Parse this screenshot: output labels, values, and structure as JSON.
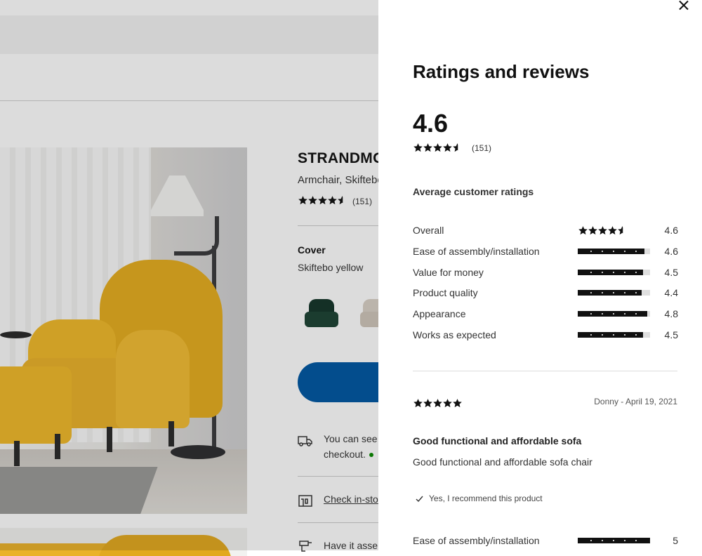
{
  "product": {
    "name": "STRANDMO",
    "subtitle": "Armchair, Skiftebo",
    "rating": 4.6,
    "reviews_count": "(151)",
    "cover_label": "Cover",
    "cover_value": "Skiftebo yellow",
    "delivery_text_1": "You can see",
    "delivery_text_2": "checkout.",
    "check_store_link": "Check in-sto",
    "assembly_text": "Have it asse"
  },
  "panel": {
    "title": "Ratings and reviews",
    "overall_score": "4.6",
    "overall_stars": 4.6,
    "overall_count": "(151)",
    "average_heading": "Average customer ratings",
    "metrics": [
      {
        "label": "Overall",
        "value": "4.6",
        "score": 4.6,
        "display": "stars"
      },
      {
        "label": "Ease of assembly/installation",
        "value": "4.6",
        "score": 4.6,
        "display": "bar"
      },
      {
        "label": "Value for money",
        "value": "4.5",
        "score": 4.5,
        "display": "bar"
      },
      {
        "label": "Product quality",
        "value": "4.4",
        "score": 4.4,
        "display": "bar"
      },
      {
        "label": "Appearance",
        "value": "4.8",
        "score": 4.8,
        "display": "bar"
      },
      {
        "label": "Works as expected",
        "value": "4.5",
        "score": 4.5,
        "display": "bar"
      }
    ],
    "review": {
      "stars": 5,
      "author_date": "Donny - April 19, 2021",
      "title": "Good functional and affordable sofa",
      "body": "Good functional and affordable sofa chair",
      "recommend": "Yes, I recommend this product",
      "sub_metric": {
        "label": "Ease of assembly/installation",
        "value": "5",
        "score": 5
      }
    }
  },
  "colors": {
    "brand_blue": "#0058a3",
    "accent_yellow": "#e5ad1f",
    "star": "#111111",
    "bar_track": "#dfdfdf",
    "in_stock": "#0a8a00"
  },
  "icons": [
    "close-icon",
    "star-icon",
    "check-icon",
    "truck-icon",
    "store-icon",
    "drill-icon"
  ]
}
